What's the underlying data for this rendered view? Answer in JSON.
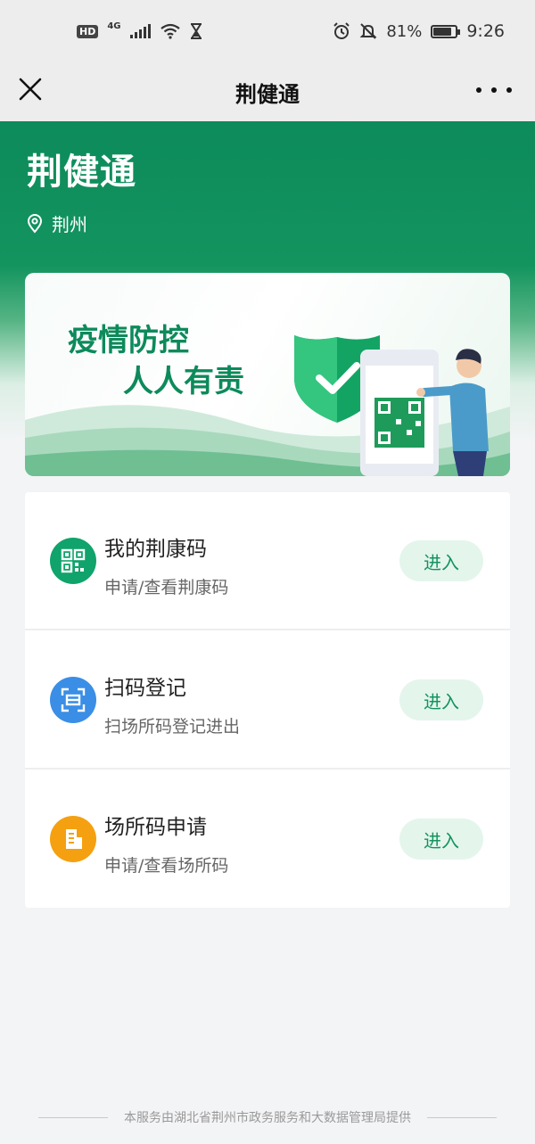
{
  "status_bar": {
    "hd": "HD",
    "network": "4G",
    "battery": "81%",
    "battery_level": 0.81,
    "time": "9:26",
    "icons": [
      "signal-icon",
      "wifi-icon",
      "hourglass-icon",
      "alarm-icon",
      "mute-icon",
      "battery-icon"
    ]
  },
  "nav": {
    "title": "荆健通",
    "icons": [
      "close-icon",
      "more-icon"
    ]
  },
  "hero": {
    "app_title": "荆健通",
    "location": "荆州",
    "location_icon": "location-pin-icon"
  },
  "banner": {
    "line1": "疫情防控",
    "line2": "人人有责"
  },
  "services": [
    {
      "title": "我的荆康码",
      "subtitle": "申请/查看荆康码",
      "button": "进入",
      "icon": "qr-code-icon",
      "color": "#10a36b"
    },
    {
      "title": "扫码登记",
      "subtitle": "扫场所码登记进出",
      "button": "进入",
      "icon": "scan-icon",
      "color": "#3a8ee6"
    },
    {
      "title": "场所码申请",
      "subtitle": "申请/查看场所码",
      "button": "进入",
      "icon": "building-icon",
      "color": "#f5a010"
    }
  ],
  "footer": {
    "text": "本服务由湖北省荆州市政务服务和大数据管理局提供"
  }
}
